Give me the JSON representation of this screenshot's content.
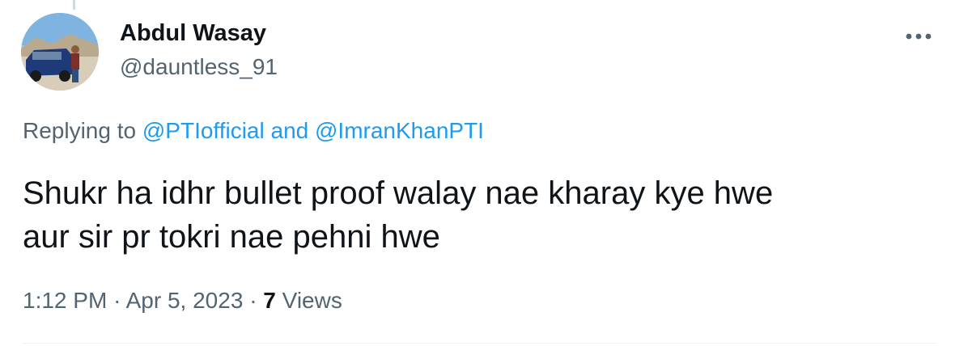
{
  "author": {
    "display_name": "Abdul Wasay",
    "handle": "@dauntless_91"
  },
  "reply": {
    "prefix": "Replying to",
    "mention_1": "@PTIofficial",
    "conjunction": "and",
    "mention_2": "@ImranKhanPTI"
  },
  "tweet": {
    "line_1": "Shukr ha idhr bullet proof walay nae kharay kye hwe",
    "line_2": "aur sir pr tokri nae pehni hwe"
  },
  "meta": {
    "time": "1:12 PM",
    "separator": "·",
    "date": "Apr 5, 2023",
    "views_count": "7",
    "views_label": "Views"
  },
  "colors": {
    "link": "#1d9bf0",
    "secondary_text": "#536471",
    "primary_text": "#0f1419"
  },
  "icons": {
    "more": "more-horizontal-icon"
  }
}
